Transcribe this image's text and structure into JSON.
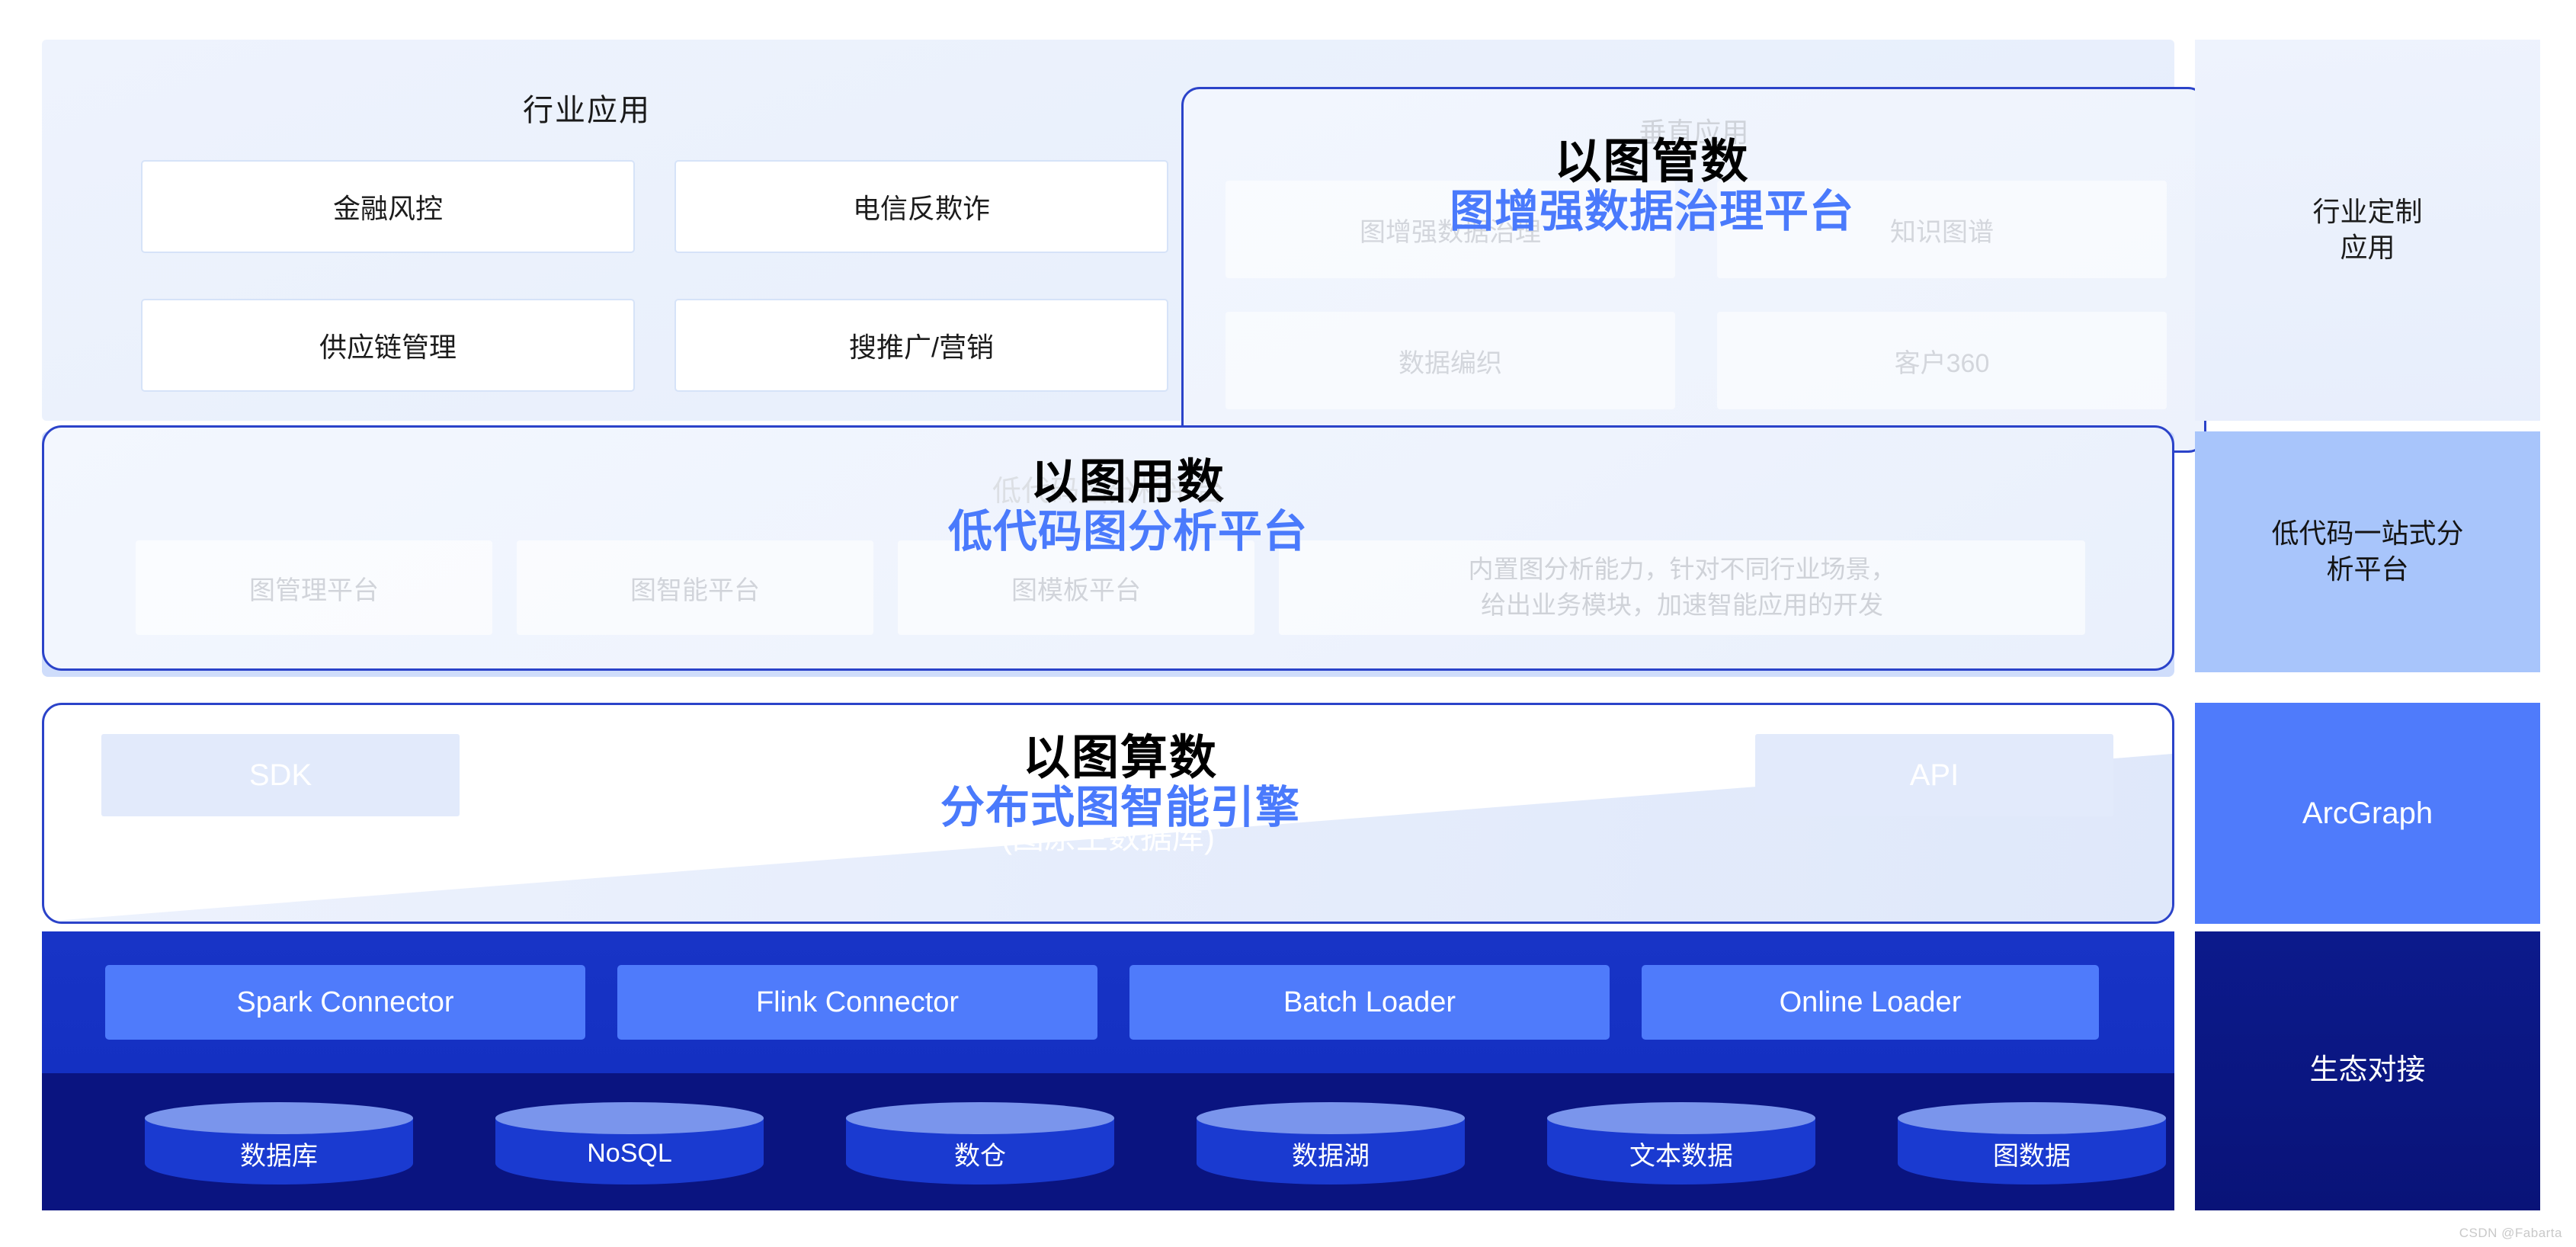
{
  "row1": {
    "title": "行业应用",
    "cards": [
      "金融风控",
      "电信反欺诈",
      "供应链管理",
      "搜推广/营销"
    ],
    "vertical_panel": {
      "title": "垂直应用",
      "cards": [
        "图增强数据治理",
        "知识图谱",
        "数据编织",
        "客户360"
      ]
    }
  },
  "row2": {
    "title": "低代码图分析平台",
    "cards": [
      "图管理平台",
      "图智能平台",
      "图模板平台"
    ],
    "desc_line1": "内置图分析能力，针对不同行业场景，",
    "desc_line2": "给出业务模块，加速智能应用的开发"
  },
  "row3": {
    "sdk": "SDK",
    "api": "API",
    "brand_name": "ArcGraph",
    "brand_sub": "(图原生数据库)"
  },
  "row4": {
    "connectors": [
      "Spark Connector",
      "Flink Connector",
      "Batch Loader",
      "Online Loader"
    ]
  },
  "row5": {
    "sources": [
      "数据库",
      "NoSQL",
      "数仓",
      "数据湖",
      "文本数据",
      "图数据"
    ]
  },
  "sidebar": {
    "items": [
      "行业定制\n应用",
      "低代码一站式分\n析平台",
      "ArcGraph",
      "生态对接"
    ]
  },
  "overlays": [
    {
      "top": "以图管数",
      "bottom": "图增强数据治理平台"
    },
    {
      "top": "以图用数",
      "bottom": "低代码图分析平台"
    },
    {
      "top": "以图算数",
      "bottom": "分布式图智能引擎"
    }
  ],
  "watermark": "CSDN @Fabarta",
  "colors": {
    "accent_blue": "#4a7afc",
    "border_blue": "#2b43c9",
    "band_blue": "#1834c6",
    "deep_navy": "#0a1480",
    "panel_bg": "#eef3fd"
  }
}
